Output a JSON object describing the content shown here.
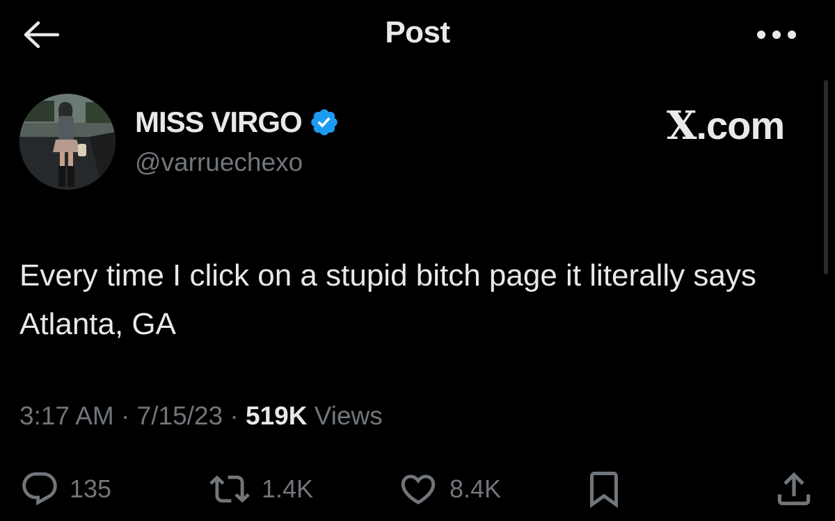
{
  "header": {
    "title": "Post",
    "back_icon": "arrow-left-icon",
    "more_icon": "more-horizontal-icon"
  },
  "author": {
    "display_name": "MISS VIRGO",
    "handle": "@varruechexo",
    "verified": true,
    "verified_color": "#1d9bf0"
  },
  "watermark": {
    "x_glyph": "X",
    "suffix": ".com"
  },
  "post": {
    "text": "Every time I click on a stupid bitch page it literally says Atlanta, GA"
  },
  "meta": {
    "time": "3:17 AM",
    "date": "7/15/23",
    "separator": " · ",
    "views_count": "519K",
    "views_label": "Views"
  },
  "actions": {
    "replies": "135",
    "reposts": "1.4K",
    "likes": "8.4K",
    "icons": [
      "reply-icon",
      "repost-icon",
      "like-icon",
      "bookmark-icon",
      "share-icon"
    ]
  },
  "colors": {
    "background": "#000000",
    "primary_text": "#e7e9ea",
    "secondary_text": "#71767b",
    "accent": "#1d9bf0"
  }
}
